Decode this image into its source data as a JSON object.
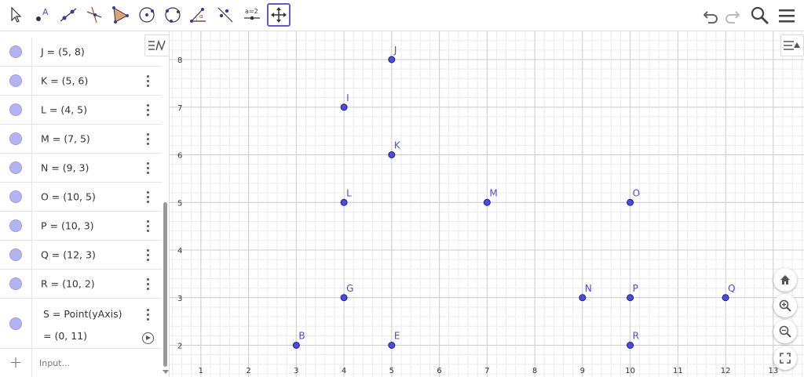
{
  "toolbar": {
    "tools": [
      {
        "name": "move-tool",
        "icon": "arrow-pointer-icon"
      },
      {
        "name": "point-tool",
        "icon": "point-icon"
      },
      {
        "name": "line-tool",
        "icon": "line-icon"
      },
      {
        "name": "perpendicular-line-tool",
        "icon": "perpendicular-icon"
      },
      {
        "name": "polygon-tool",
        "icon": "polygon-icon"
      },
      {
        "name": "circle-tool",
        "icon": "circle-center-icon"
      },
      {
        "name": "conic-tool",
        "icon": "circle-three-points-icon"
      },
      {
        "name": "angle-tool",
        "icon": "angle-icon"
      },
      {
        "name": "reflect-tool",
        "icon": "reflect-icon"
      },
      {
        "name": "slider-tool",
        "icon": "slider-icon",
        "label": "a=2"
      },
      {
        "name": "move-graphics-tool",
        "icon": "move-graphics-icon",
        "active": true
      }
    ],
    "right": [
      "undo-icon",
      "redo-icon",
      "search-icon",
      "menu-icon"
    ]
  },
  "algebra": {
    "rows": [
      {
        "name": "J",
        "def": "J = (5, 8)"
      },
      {
        "name": "K",
        "def": "K = (5, 6)"
      },
      {
        "name": "L",
        "def": "L = (4, 5)"
      },
      {
        "name": "M",
        "def": "M = (7, 5)"
      },
      {
        "name": "N",
        "def": "N = (9, 3)"
      },
      {
        "name": "O",
        "def": "O = (10, 5)"
      },
      {
        "name": "P",
        "def": "P = (10, 3)"
      },
      {
        "name": "Q",
        "def": "Q = (12, 3)"
      },
      {
        "name": "R",
        "def": "R = (10, 2)"
      }
    ],
    "s_row": {
      "def": "S = Point(yAxis)",
      "value": "= (0, 11)"
    },
    "input_placeholder": "Input...",
    "add_label": "+"
  },
  "graph": {
    "x_ticks": [
      "1",
      "2",
      "3",
      "4",
      "5",
      "6",
      "7",
      "8",
      "9",
      "10",
      "11",
      "12",
      "13"
    ],
    "y_ticks": [
      "2",
      "3",
      "4",
      "5",
      "6",
      "7",
      "8"
    ],
    "points": [
      {
        "label": "J",
        "x": 5,
        "y": 8
      },
      {
        "label": "I",
        "x": 4,
        "y": 7
      },
      {
        "label": "K",
        "x": 5,
        "y": 6
      },
      {
        "label": "L",
        "x": 4,
        "y": 5
      },
      {
        "label": "M",
        "x": 7,
        "y": 5
      },
      {
        "label": "O",
        "x": 10,
        "y": 5
      },
      {
        "label": "G",
        "x": 4,
        "y": 3
      },
      {
        "label": "N",
        "x": 9,
        "y": 3
      },
      {
        "label": "P",
        "x": 10,
        "y": 3
      },
      {
        "label": "Q",
        "x": 12,
        "y": 3
      },
      {
        "label": "B",
        "x": 3,
        "y": 2
      },
      {
        "label": "E",
        "x": 5,
        "y": 2
      },
      {
        "label": "R",
        "x": 10,
        "y": 2
      }
    ],
    "point_color": "#4c4cdb"
  }
}
